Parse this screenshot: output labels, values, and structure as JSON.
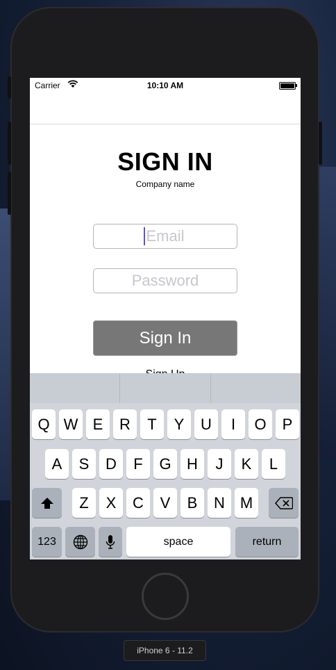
{
  "status_bar": {
    "carrier": "Carrier",
    "time": "10:10 AM"
  },
  "login": {
    "title": "SIGN IN",
    "subtitle": "Company name",
    "email_placeholder": "Email",
    "password_placeholder": "Password",
    "sign_in_label": "Sign In",
    "sign_up_label": "Sign Up"
  },
  "keyboard": {
    "row1": [
      "Q",
      "W",
      "E",
      "R",
      "T",
      "Y",
      "U",
      "I",
      "O",
      "P"
    ],
    "row2": [
      "A",
      "S",
      "D",
      "F",
      "G",
      "H",
      "J",
      "K",
      "L"
    ],
    "row3": [
      "Z",
      "X",
      "C",
      "V",
      "B",
      "N",
      "M"
    ],
    "numbers_label": "123",
    "space_label": "space",
    "return_label": "return"
  },
  "simulator_label": "iPhone 6 - 11.2"
}
